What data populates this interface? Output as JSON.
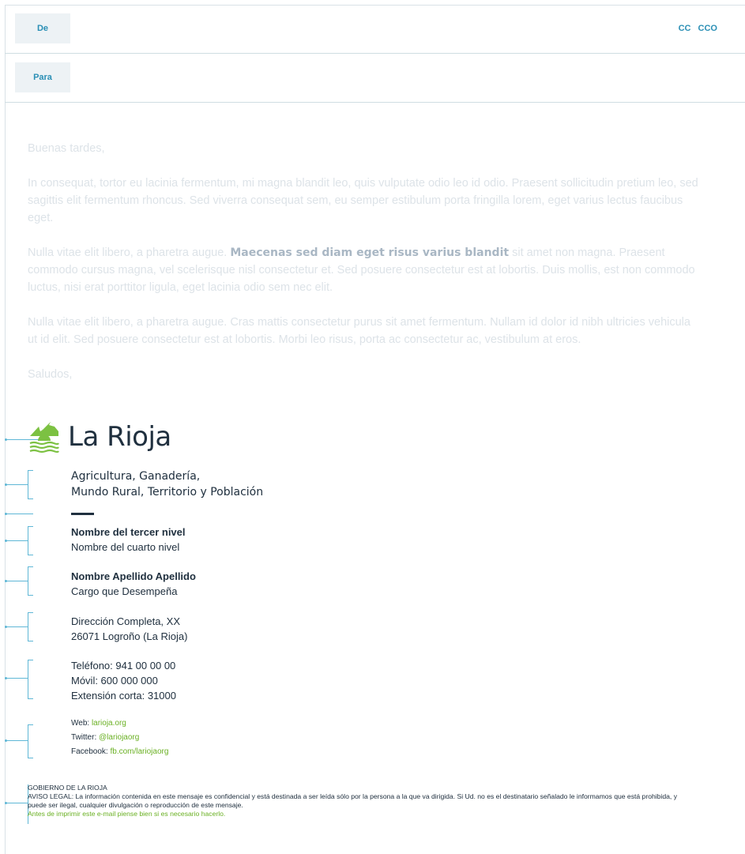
{
  "header": {
    "from_label": "De",
    "to_label": "Para",
    "cc_label": "CC",
    "cco_label": "CCO"
  },
  "message": {
    "greeting": "Buenas tardes,",
    "p1": "In consequat, tortor eu lacinia fermentum, mi magna blandit leo, quis vulputate odio leo id odio. Praesent sollicitudin pretium leo, sed sagittis elit fermentum rhoncus. Sed viverra consequat sem, eu semper estibulum porta fringilla lorem, eget varius lectus faucibus eget.",
    "p2_before": "Nulla vitae elit libero, a pharetra augue. ",
    "p2_highlight": "Maecenas sed diam eget risus varius blandit",
    "p2_after": " sit amet non magna. Praesent commodo cursus magna, vel scelerisque nisl consectetur et. Sed posuere consectetur est at lobortis. Duis mollis, est non commodo luctus, nisi erat porttitor ligula, eget lacinia odio sem nec elit.",
    "p3": "Nulla vitae elit libero, a pharetra augue. Cras mattis consectetur purus sit amet fermentum. Nullam id dolor id nibh ultricies vehicula ut id elit. Sed posuere consectetur est at lobortis. Morbi leo risus, porta ac consectetur ac, vestibulum at eros.",
    "closing": "Saludos,"
  },
  "signature": {
    "logo_text": "La Rioja",
    "logo_icon": "la-rioja-logo-icon",
    "dept_line1": "Agricultura, Ganadería,",
    "dept_line2": "Mundo Rural, Territorio y Población",
    "level3": "Nombre del tercer nivel",
    "level4": "Nombre del cuarto nivel",
    "name": "Nombre Apellido Apellido",
    "position": "Cargo que Desempeña",
    "address1": "Dirección Completa, XX",
    "address2": "26071 Logroño (La Rioja)",
    "phone": "Teléfono: 941 00 00 00",
    "mobile": "Móvil: 600 000 000",
    "extension": "Extensión corta: 31000",
    "web_label": "Web: ",
    "web_value": "larioja.org",
    "twitter_label": "Twitter: ",
    "twitter_value": "@lariojaorg",
    "facebook_label": "Facebook: ",
    "facebook_value": "fb.com/lariojaorg",
    "legal_org": "GOBIERNO DE LA RIOJA",
    "legal_text": "AVISO LEGAL: La información contenida en este mensaje es confidencial y está destinada a ser leída sólo por la persona a la que va dirigida. Si Ud. no es el destinatario señalado le informamos que está prohibida, y puede ser ilegal, cualquier divulgación o reproducción de este mensaje.",
    "eco_note": "Antes de imprimir este e-mail piense bien si es necesario hacerlo."
  },
  "colors": {
    "accent_blue": "#2a8fb5",
    "brand_green": "#6ab023",
    "text_dark": "#20303f",
    "placeholder_text": "#dde3e8"
  }
}
